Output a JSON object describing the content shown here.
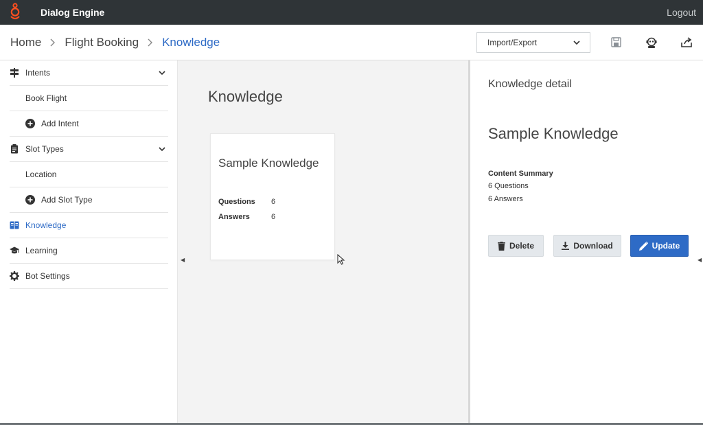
{
  "app": {
    "title": "Dialog Engine",
    "logout": "Logout"
  },
  "breadcrumb": {
    "home": "Home",
    "bot": "Flight Booking",
    "current": "Knowledge"
  },
  "toolbar": {
    "import_export": "Import/Export"
  },
  "sidebar": {
    "intents": "Intents",
    "book_flight": "Book Flight",
    "add_intent": "Add Intent",
    "slot_types": "Slot Types",
    "location": "Location",
    "add_slot_type": "Add Slot Type",
    "knowledge": "Knowledge",
    "learning": "Learning",
    "bot_settings": "Bot Settings"
  },
  "main": {
    "title": "Knowledge",
    "card": {
      "title": "Sample Knowledge",
      "questions_label": "Questions",
      "questions_value": "6",
      "answers_label": "Answers",
      "answers_value": "6"
    }
  },
  "detail": {
    "heading": "Knowledge detail",
    "title": "Sample Knowledge",
    "summary_label": "Content Summary",
    "questions_line": "6 Questions",
    "answers_line": "6 Answers",
    "delete": "Delete",
    "download": "Download",
    "update": "Update"
  },
  "colors": {
    "accent": "#2e6bc6",
    "topbar": "#2f3437",
    "logo": "#ff4f1f"
  }
}
